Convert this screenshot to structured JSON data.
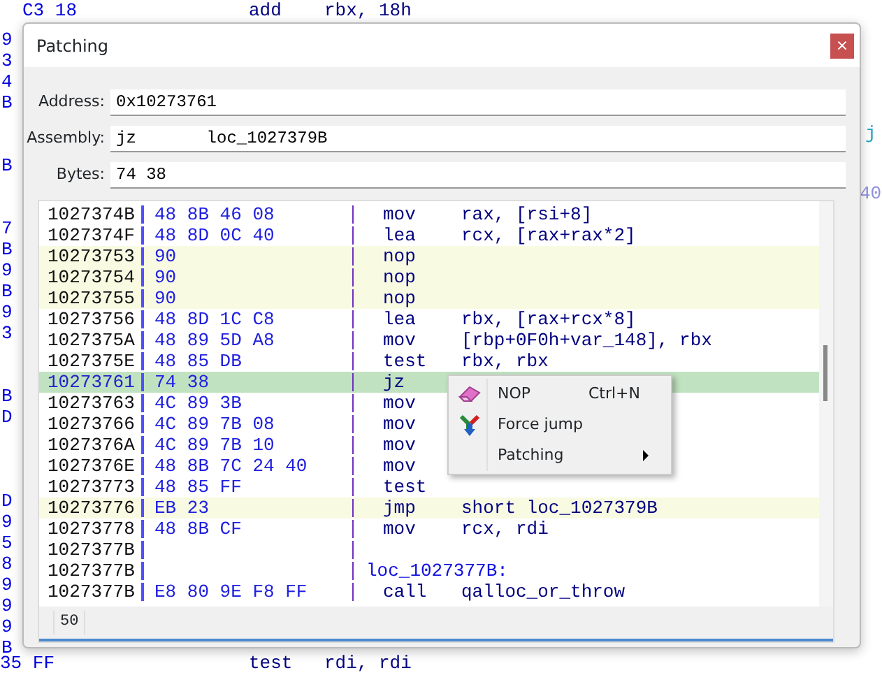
{
  "background": {
    "top_line": {
      "bytes": "C3 18",
      "mnemonic": "add",
      "operands": "rbx, 18h"
    },
    "margin": [
      {
        "kind": "hex",
        "text": "9"
      },
      {
        "kind": "hex",
        "text": "3"
      },
      {
        "kind": "hex",
        "text": "4"
      },
      {
        "kind": "hex",
        "text": "B"
      },
      {
        "kind": "gap"
      },
      {
        "kind": "gap"
      },
      {
        "kind": "hex",
        "text": "B"
      },
      {
        "kind": "gap"
      },
      {
        "kind": "gap"
      },
      {
        "kind": "hex",
        "text": "7"
      },
      {
        "kind": "hex",
        "text": "B"
      },
      {
        "kind": "hex",
        "text": "9"
      },
      {
        "kind": "hex",
        "text": "B"
      },
      {
        "kind": "hex",
        "text": "9"
      },
      {
        "kind": "hex",
        "text": "3"
      },
      {
        "kind": "gap"
      },
      {
        "kind": "gap"
      },
      {
        "kind": "hex",
        "text": "B"
      },
      {
        "kind": "hex",
        "text": "D"
      },
      {
        "kind": "gap"
      },
      {
        "kind": "gap"
      },
      {
        "kind": "gap"
      },
      {
        "kind": "hex",
        "text": "D"
      },
      {
        "kind": "hex",
        "text": "9"
      },
      {
        "kind": "hex",
        "text": "5"
      },
      {
        "kind": "hex",
        "text": "8"
      },
      {
        "kind": "hex",
        "text": "9"
      },
      {
        "kind": "hex",
        "text": "9"
      },
      {
        "kind": "hex",
        "text": "9"
      },
      {
        "kind": "hex",
        "text": "B"
      }
    ],
    "right_marks": [
      "j",
      "40"
    ],
    "bottom_lines": [
      {
        "bytes": "35 FF",
        "mnemonic": "test",
        "operands": "rdi, rdi"
      }
    ]
  },
  "dialog": {
    "title": "Patching",
    "close": "×",
    "fields": [
      {
        "label": "Address:",
        "value": "0x10273761"
      },
      {
        "label": "Assembly:",
        "value": "jz       loc_1027379B"
      },
      {
        "label": "Bytes:",
        "value": "74 38"
      }
    ],
    "listing": [
      {
        "kind": "code",
        "patched": false,
        "selected": false,
        "address": "1027374B",
        "bytes": "48 8B 46 08",
        "mnemonic": "mov",
        "operands": "rax, [rsi+8]"
      },
      {
        "kind": "code",
        "patched": false,
        "selected": false,
        "address": "1027374F",
        "bytes": "48 8D 0C 40",
        "mnemonic": "lea",
        "operands": "rcx, [rax+rax*2]"
      },
      {
        "kind": "code",
        "patched": true,
        "selected": false,
        "address": "10273753",
        "bytes": "90",
        "mnemonic": "nop"
      },
      {
        "kind": "code",
        "patched": true,
        "selected": false,
        "address": "10273754",
        "bytes": "90",
        "mnemonic": "nop"
      },
      {
        "kind": "code",
        "patched": true,
        "selected": false,
        "address": "10273755",
        "bytes": "90",
        "mnemonic": "nop"
      },
      {
        "kind": "code",
        "patched": false,
        "selected": false,
        "address": "10273756",
        "bytes": "48 8D 1C C8",
        "mnemonic": "lea",
        "operands": "rbx, [rax+rcx*8]"
      },
      {
        "kind": "code",
        "patched": false,
        "selected": false,
        "address": "1027375A",
        "bytes": "48 89 5D A8",
        "mnemonic": "mov",
        "operands": "[rbp+0F0h+var_148], rbx"
      },
      {
        "kind": "code",
        "patched": false,
        "selected": false,
        "address": "1027375E",
        "bytes": "48 85 DB",
        "mnemonic": "test",
        "operands": "rbx, rbx"
      },
      {
        "kind": "code",
        "patched": false,
        "selected": true,
        "address": "10273761",
        "bytes": "74 38",
        "mnemonic": "jz"
      },
      {
        "kind": "code",
        "patched": false,
        "selected": false,
        "address": "10273763",
        "bytes": "4C 89 3B",
        "mnemonic": "mov"
      },
      {
        "kind": "code",
        "patched": false,
        "selected": false,
        "address": "10273766",
        "bytes": "4C 89 7B 08",
        "mnemonic": "mov"
      },
      {
        "kind": "code",
        "patched": false,
        "selected": false,
        "address": "1027376A",
        "bytes": "4C 89 7B 10",
        "mnemonic": "mov"
      },
      {
        "kind": "code",
        "patched": false,
        "selected": false,
        "address": "1027376E",
        "bytes": "48 8B 7C 24 40",
        "mnemonic": "mov"
      },
      {
        "kind": "code",
        "patched": false,
        "selected": false,
        "address": "10273773",
        "bytes": "48 85 FF",
        "mnemonic": "test"
      },
      {
        "kind": "code",
        "patched": true,
        "selected": false,
        "address": "10273776",
        "bytes": "EB 23",
        "mnemonic": "jmp",
        "operands": "short loc_1027379B"
      },
      {
        "kind": "code",
        "patched": false,
        "selected": false,
        "address": "10273778",
        "bytes": "48 8B CF",
        "mnemonic": "mov",
        "operands": "rcx, rdi"
      },
      {
        "kind": "blank",
        "patched": false,
        "selected": false,
        "address": "1027377B"
      },
      {
        "kind": "label",
        "patched": false,
        "selected": false,
        "address": "1027377B",
        "label": "loc_1027377B:"
      },
      {
        "kind": "code",
        "patched": false,
        "selected": false,
        "address": "1027377B",
        "bytes": "E8 80 9E F8 FF",
        "mnemonic": "call",
        "operands": "qalloc_or_throw"
      }
    ],
    "status": "50"
  },
  "context_menu": [
    {
      "label": "NOP",
      "shortcut": "Ctrl+N",
      "submenu": false
    },
    {
      "label": "Force jump",
      "submenu": false
    },
    {
      "label": "Patching",
      "submenu": true
    }
  ]
}
